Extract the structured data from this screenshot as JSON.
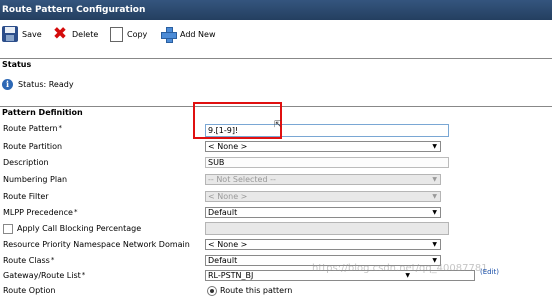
{
  "window": {
    "title": "Route Pattern Configuration"
  },
  "toolbar": {
    "save": "Save",
    "delete": "Delete",
    "copy": "Copy",
    "add_new": "Add New"
  },
  "status": {
    "section_title": "Status",
    "text": "Status: Ready"
  },
  "pattern": {
    "section_title": "Pattern Definition",
    "route_pattern": {
      "label": "Route Pattern",
      "required": "*",
      "value": "9.[1-9]!"
    },
    "route_partition": {
      "label": "Route Partition",
      "value": "< None >"
    },
    "description": {
      "label": "Description",
      "value": "SUB"
    },
    "numbering_plan": {
      "label": "Numbering Plan",
      "value": "-- Not Selected --"
    },
    "route_filter": {
      "label": "Route Filter",
      "value": "< None >"
    },
    "mlpp_precedence": {
      "label": "MLPP Precedence",
      "required": "*",
      "value": "Default"
    },
    "call_blocking": {
      "label": "Apply Call Blocking Percentage"
    },
    "resource_priority": {
      "label": "Resource Priority Namespace Network Domain",
      "value": "< None >"
    },
    "route_class": {
      "label": "Route Class",
      "required": "*",
      "value": "Default"
    },
    "gateway_route_list": {
      "label": "Gateway/Route List",
      "required": "*",
      "value": "RL-PSTN_BJ",
      "edit_link": "(Edit)"
    },
    "route_option": {
      "label": "Route Option",
      "radio_label": "Route this pattern"
    }
  },
  "watermark": "https://blog.csdn.net/qq_40087781"
}
